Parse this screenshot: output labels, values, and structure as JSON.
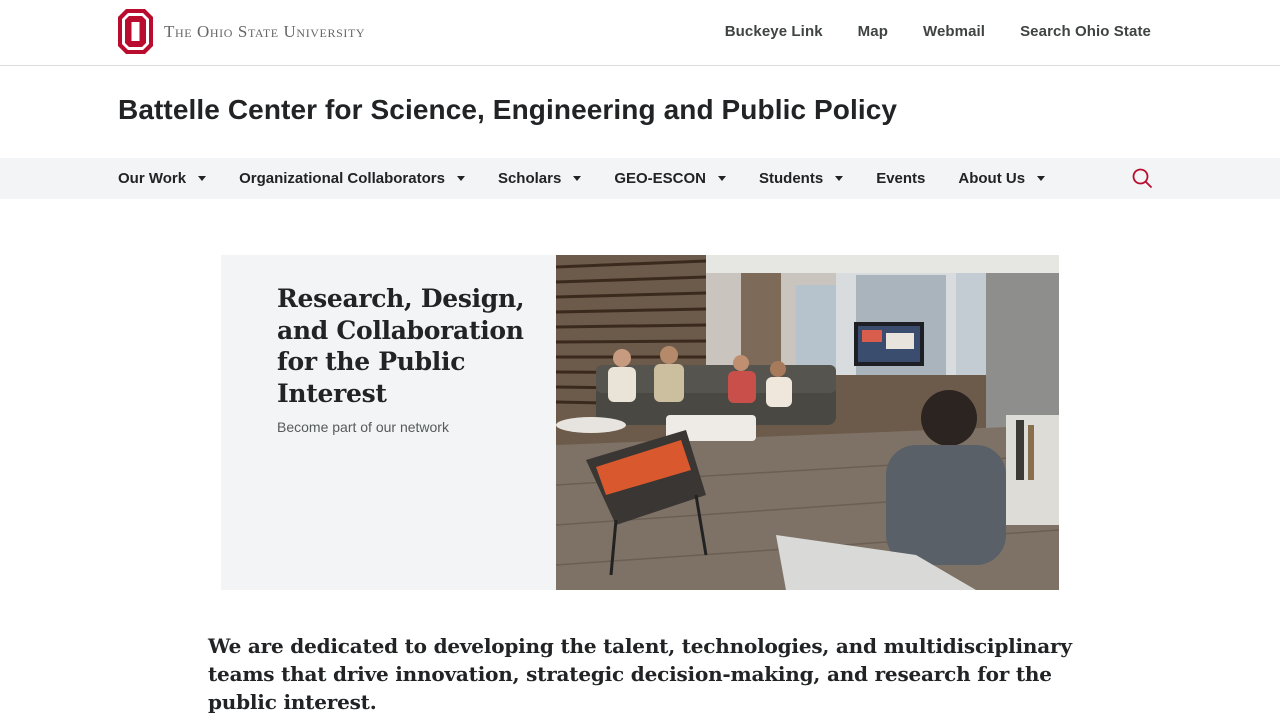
{
  "header": {
    "university_name": "The Ohio State University",
    "logo_icon": "block-o-logo-icon",
    "brand_color": "#ba0c2f",
    "links": [
      {
        "label": "Buckeye Link"
      },
      {
        "label": "Map"
      },
      {
        "label": "Webmail"
      },
      {
        "label": "Search Ohio State"
      }
    ]
  },
  "site": {
    "title": "Battelle Center for Science, Engineering and Public Policy"
  },
  "nav": {
    "items": [
      {
        "label": "Our Work",
        "dropdown": true
      },
      {
        "label": "Organizational Collaborators",
        "dropdown": true
      },
      {
        "label": "Scholars",
        "dropdown": true
      },
      {
        "label": "GEO-ESCON",
        "dropdown": true
      },
      {
        "label": "Students",
        "dropdown": true
      },
      {
        "label": "Events",
        "dropdown": false
      },
      {
        "label": "About Us",
        "dropdown": true
      }
    ],
    "search_icon": "search-icon"
  },
  "hero": {
    "title": "Research, Design, and Collaboration for the Public Interest",
    "subtitle": "Become part of our network",
    "photo": "students-seated-in-lounge-photo"
  },
  "mission": {
    "text": "We are dedicated to developing the talent, technologies, and multidisciplinary teams that drive innovation, strategic decision-making, and research for the public interest."
  }
}
